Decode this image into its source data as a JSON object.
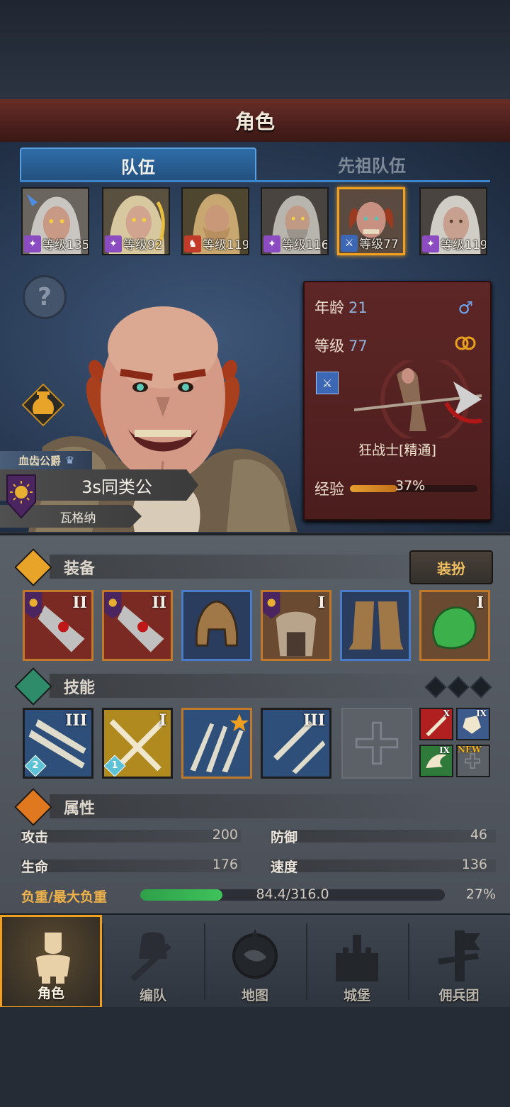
{
  "header": {
    "title": "角色"
  },
  "tabs": [
    {
      "label": "队伍"
    },
    {
      "label": "先祖队伍"
    }
  ],
  "roster": [
    {
      "level": "等级135",
      "class_color": "#8a4cc0"
    },
    {
      "level": "等级92",
      "class_color": "#8a4cc0"
    },
    {
      "level": "等级119",
      "class_color": "#c23a2a"
    },
    {
      "level": "等级116",
      "class_color": "#8a4cc0"
    },
    {
      "level": "等级77",
      "class_color": "#3b67b5",
      "selected": true
    },
    {
      "level": "等级119",
      "class_color": "#8a4cc0"
    }
  ],
  "hero": {
    "noble_title": "血齿公爵",
    "name": "3s同类公",
    "subname": "瓦格纳",
    "age_label": "年龄",
    "age": "21",
    "gender_icon": "male-icon",
    "level_label": "等级",
    "level": "77",
    "class_name": "狂战士[精通]",
    "exp_label": "经验",
    "exp_percent": "37%",
    "exp_fraction": 0.37
  },
  "equipment": {
    "title": "装备",
    "dress_button": "装扮",
    "slots": [
      {
        "name": "weapon-axe-slot",
        "tier": "II",
        "rarity": "orange"
      },
      {
        "name": "weapon-axe-slot-2",
        "tier": "II",
        "rarity": "orange"
      },
      {
        "name": "helmet-slot",
        "tier": "",
        "rarity": "blue"
      },
      {
        "name": "armor-slot",
        "tier": "I",
        "rarity": "orange"
      },
      {
        "name": "boots-slot",
        "tier": "",
        "rarity": "blue"
      },
      {
        "name": "trinket-slot",
        "tier": "I",
        "rarity": "orange"
      }
    ]
  },
  "skills": {
    "title": "技能",
    "items": [
      {
        "tier": "III",
        "pin": "2",
        "bg": "#2e4f7a"
      },
      {
        "tier": "I",
        "pin": "1",
        "bg": "#b08a1e"
      },
      {
        "tier": "",
        "pin": "",
        "bg": "#2e4f7a",
        "star": true
      },
      {
        "tier": "III",
        "pin": "",
        "bg": "#2e4f7a"
      }
    ],
    "mini": [
      {
        "tier": "X",
        "bg": "#b02020"
      },
      {
        "tier": "IX",
        "bg": "#3c5a8c"
      },
      {
        "tier": "IX",
        "bg": "#2f7a3a"
      },
      {
        "tier": "NEW",
        "bg": "#5b6067"
      }
    ]
  },
  "attributes": {
    "title": "属性",
    "rows": [
      {
        "label": "攻击",
        "value": "200",
        "label2": "防御",
        "value2": "46"
      },
      {
        "label": "生命",
        "value": "176",
        "label2": "速度",
        "value2": "136"
      }
    ],
    "load_label": "负重/最大负重",
    "load_text": "84.4/316.0",
    "load_percent": "27%",
    "load_fraction": 0.27
  },
  "nav": [
    {
      "label": "角色",
      "active": true
    },
    {
      "label": "编队"
    },
    {
      "label": "地图"
    },
    {
      "label": "城堡"
    },
    {
      "label": "佣兵团"
    }
  ],
  "colors": {
    "accent": "#f0a020",
    "tab_blue": "#2f6da8",
    "card_red": "#5e2626",
    "load_green": "#3ec25a"
  }
}
